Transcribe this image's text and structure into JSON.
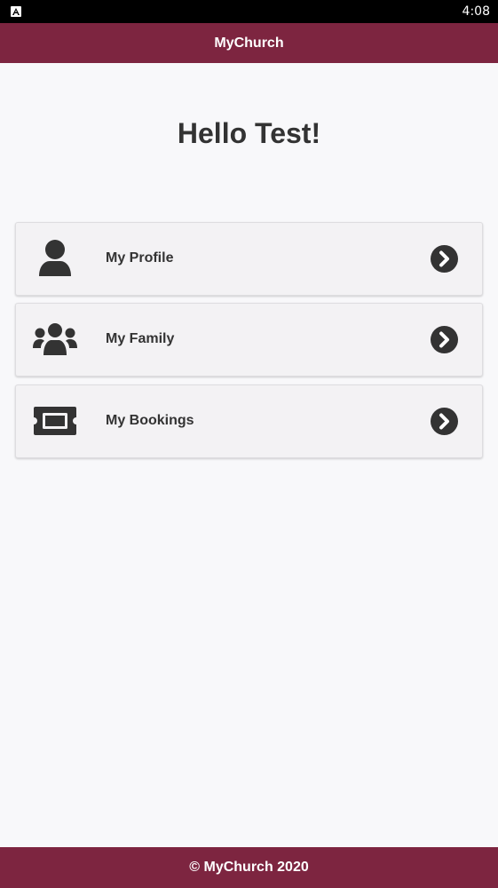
{
  "status_bar": {
    "time": "4:08",
    "app_icon": "android-a-icon"
  },
  "app_bar": {
    "title": "MyChurch",
    "color": "#7d2540"
  },
  "main": {
    "greeting": "Hello Test!",
    "menu": [
      {
        "label": "My Profile",
        "icon": "user-icon"
      },
      {
        "label": "My Family",
        "icon": "users-icon"
      },
      {
        "label": "My Bookings",
        "icon": "ticket-icon"
      }
    ],
    "chevron_icon": "chevron-circle-right-icon"
  },
  "footer": {
    "text": "© MyChurch 2020"
  }
}
